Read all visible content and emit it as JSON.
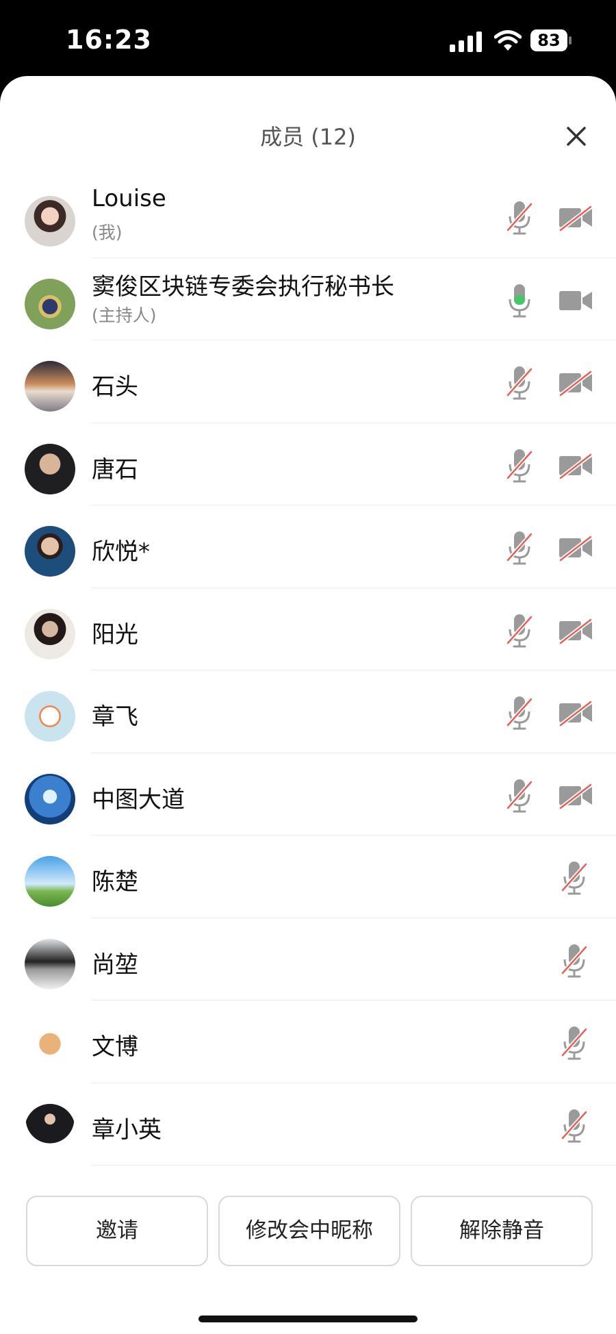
{
  "status_bar": {
    "time": "16:23",
    "battery": "83"
  },
  "sheet": {
    "title": "成员 (12)"
  },
  "colors": {
    "muted_slash": "#e4605a",
    "active_mic": "#44c767",
    "icon_gray": "#9a9a9a"
  },
  "members": [
    {
      "name": "Louise",
      "sub": "(我)",
      "mic": "muted",
      "camera": "off"
    },
    {
      "name": "窦俊区块链专委会执行秘书长",
      "sub": "(主持人)",
      "mic": "on",
      "camera": "on"
    },
    {
      "name": "石头",
      "mic": "muted",
      "camera": "off"
    },
    {
      "name": "唐石",
      "mic": "muted",
      "camera": "off"
    },
    {
      "name": "欣悦*",
      "mic": "muted",
      "camera": "off"
    },
    {
      "name": "阳光",
      "mic": "muted",
      "camera": "off"
    },
    {
      "name": "章飞",
      "mic": "muted",
      "camera": "off"
    },
    {
      "name": "中图大道",
      "mic": "muted",
      "camera": "off"
    },
    {
      "name": "陈楚",
      "mic": "muted"
    },
    {
      "name": "尚堃",
      "mic": "muted"
    },
    {
      "name": "文博",
      "mic": "muted"
    },
    {
      "name": "章小英",
      "mic": "muted"
    }
  ],
  "buttons": {
    "invite": "邀请",
    "rename": "修改会中昵称",
    "unmute": "解除静音"
  }
}
